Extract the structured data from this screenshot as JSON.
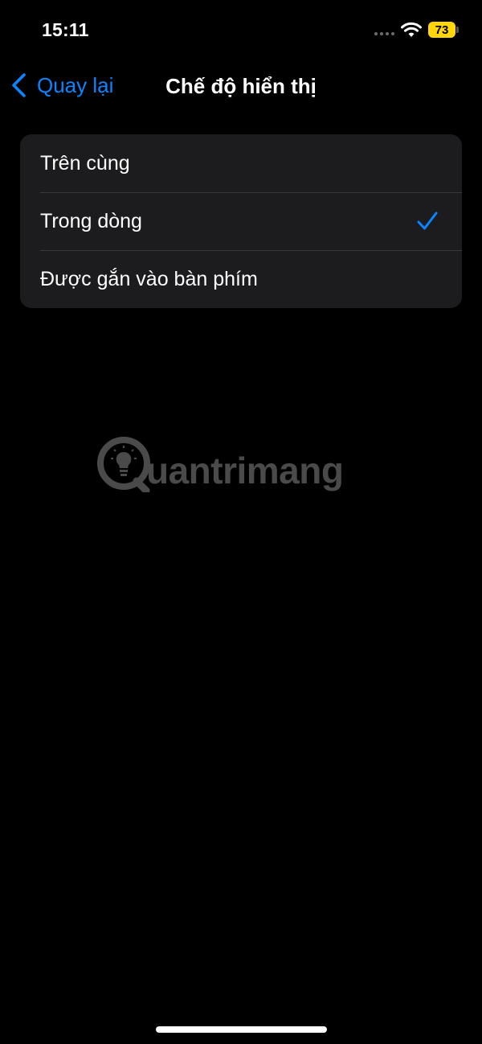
{
  "status_bar": {
    "time": "15:11",
    "battery": "73",
    "battery_color": "#ffd60a",
    "icons": [
      "signal-dots-icon",
      "wifi-icon",
      "battery-icon"
    ]
  },
  "nav": {
    "back_label": "Quay lại",
    "title": "Chế độ hiển thị",
    "accent_color": "#0a84ff"
  },
  "options": [
    {
      "label": "Trên cùng",
      "selected": false
    },
    {
      "label": "Trong dòng",
      "selected": true
    },
    {
      "label": "Được gắn vào bàn phím",
      "selected": false
    }
  ],
  "watermark": {
    "text": "uantrimang"
  },
  "colors": {
    "background": "#000000",
    "group_background": "#1c1c1e",
    "separator": "#38383a"
  }
}
